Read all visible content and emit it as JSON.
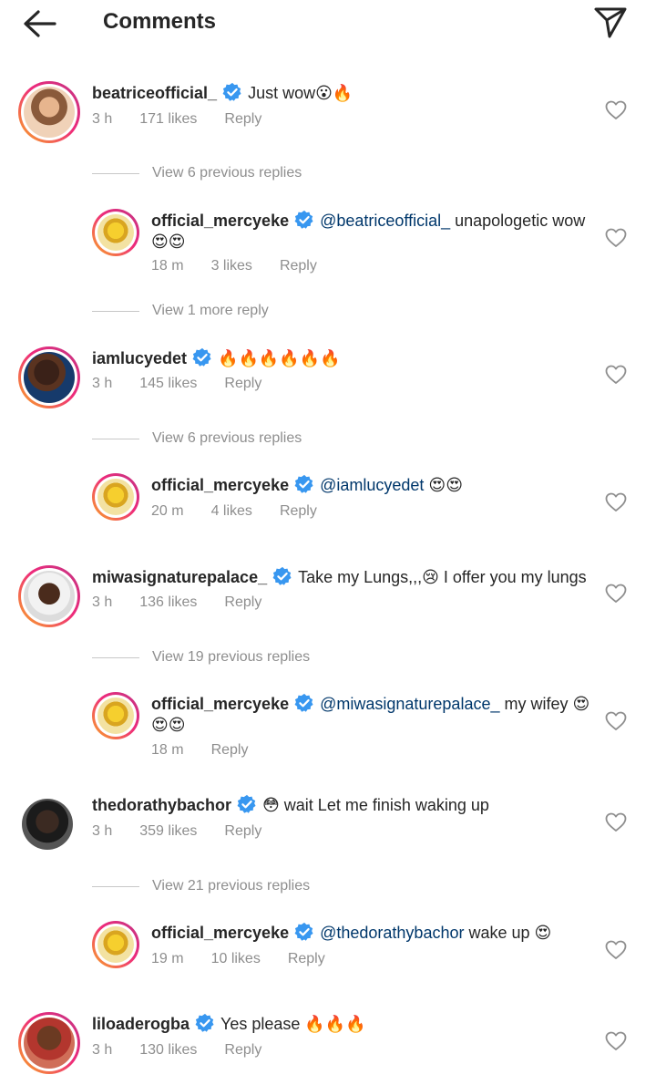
{
  "header": {
    "title": "Comments",
    "back_icon": "arrow-left-icon",
    "share_icon": "paper-plane-icon"
  },
  "colors": {
    "text": "#262626",
    "muted": "#8e8e8e",
    "mention": "#00376b",
    "verified": "#3897f0"
  },
  "comments": [
    {
      "user": "beatriceofficial_",
      "text": "Just wow😮🔥",
      "time": "3 h",
      "likes": "171 likes",
      "reply": "Reply"
    },
    {
      "view": "View 6 previous replies"
    },
    {
      "user": "official_mercyeke",
      "mention": "@beatriceofficial_",
      "text": " unapologetic wow",
      "text2": "😍😍",
      "time": "18 m",
      "likes": "3 likes",
      "reply": "Reply"
    },
    {
      "view": "View 1 more reply"
    },
    {
      "user": "iamlucyedet",
      "text": "🔥🔥🔥🔥🔥🔥",
      "time": "3 h",
      "likes": "145 likes",
      "reply": "Reply"
    },
    {
      "view": "View 6 previous replies"
    },
    {
      "user": "official_mercyeke",
      "mention": "@iamlucyedet",
      "text": " 😍😍",
      "time": "20 m",
      "likes": "4 likes",
      "reply": "Reply"
    },
    {
      "user": "miwasignaturepalace_",
      "text": "Take my Lungs,,,😢 I offer you my lungs",
      "time": "3 h",
      "likes": "136 likes",
      "reply": "Reply"
    },
    {
      "view": "View 19 previous replies"
    },
    {
      "user": "official_mercyeke",
      "mention": "@miwasignaturepalace_",
      "text": " my wifey 😍",
      "text2": "😍😍",
      "time": "18 m",
      "reply": "Reply"
    },
    {
      "user": "thedorathybachor",
      "text": "😳 wait Let me finish waking up",
      "time": "3 h",
      "likes": "359 likes",
      "reply": "Reply"
    },
    {
      "view": "View 21 previous replies"
    },
    {
      "user": "official_mercyeke",
      "mention": "@thedorathybachor",
      "text": " wake up 😍",
      "time": "19 m",
      "likes": "10 likes",
      "reply": "Reply"
    },
    {
      "user": "liloaderogba",
      "text": "Yes please 🔥🔥🔥",
      "time": "3 h",
      "likes": "130 likes",
      "reply": "Reply"
    }
  ]
}
